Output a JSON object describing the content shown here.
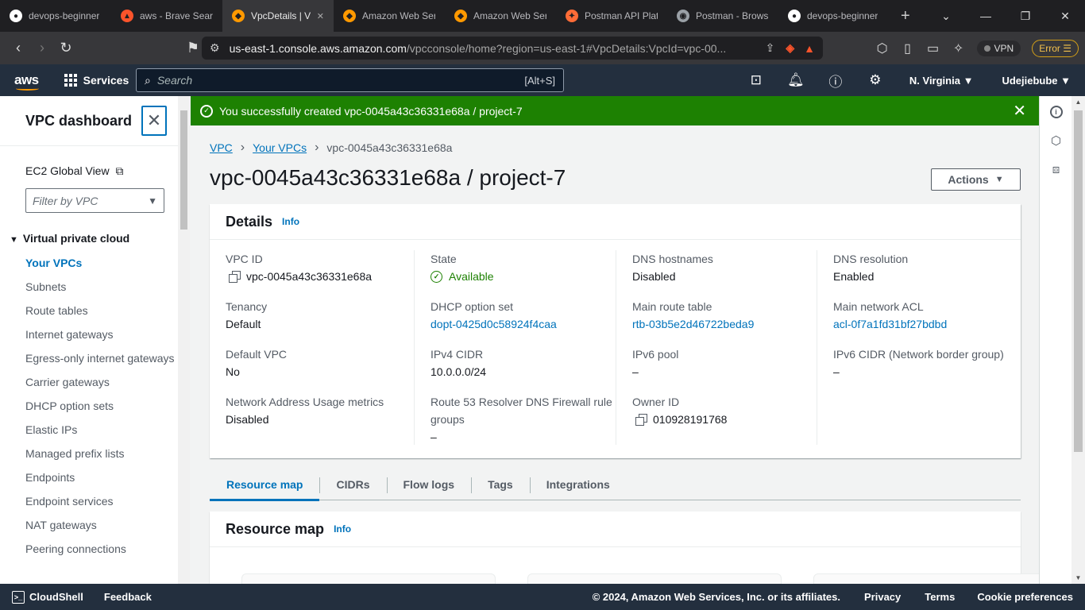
{
  "browser": {
    "tabs": [
      {
        "title": "devops-beginner",
        "icon": "github-icon",
        "color": "#ffffff"
      },
      {
        "title": "aws - Brave Searc",
        "icon": "brave-icon",
        "color": "#fb542b"
      },
      {
        "title": "VpcDetails | V",
        "icon": "aws-cube-icon",
        "color": "#ff9900",
        "active": true
      },
      {
        "title": "Amazon Web Ser",
        "icon": "aws-cube-icon",
        "color": "#ff9900"
      },
      {
        "title": "Amazon Web Ser",
        "icon": "aws-cube-icon",
        "color": "#ff9900"
      },
      {
        "title": "Postman API Plat",
        "icon": "postman-icon",
        "color": "#ff6c37"
      },
      {
        "title": "Postman - Brows",
        "icon": "globe-icon",
        "color": "#9aa0a6"
      },
      {
        "title": "devops-beginner",
        "icon": "github-icon",
        "color": "#ffffff"
      }
    ],
    "url_host": "us-east-1.console.aws.amazon.com",
    "url_path": "/vpcconsole/home?region=us-east-1#VpcDetails:VpcId=vpc-00...",
    "vpn_label": "VPN",
    "error_label": "Error",
    "brave_badge": "1"
  },
  "awsnav": {
    "logo": "aws",
    "services": "Services",
    "search_placeholder": "Search",
    "search_shortcut": "[Alt+S]",
    "region": "N. Virginia",
    "account": "Udejiebube"
  },
  "sidebar": {
    "title": "VPC dashboard",
    "global_view": "EC2 Global View",
    "filter_placeholder": "Filter by VPC",
    "section": "Virtual private cloud",
    "items": [
      {
        "label": "Your VPCs",
        "active": true
      },
      {
        "label": "Subnets"
      },
      {
        "label": "Route tables"
      },
      {
        "label": "Internet gateways"
      },
      {
        "label": "Egress-only internet gateways"
      },
      {
        "label": "Carrier gateways"
      },
      {
        "label": "DHCP option sets"
      },
      {
        "label": "Elastic IPs"
      },
      {
        "label": "Managed prefix lists"
      },
      {
        "label": "Endpoints"
      },
      {
        "label": "Endpoint services"
      },
      {
        "label": "NAT gateways"
      },
      {
        "label": "Peering connections"
      }
    ]
  },
  "flash": {
    "message": "You successfully created vpc-0045a43c36331e68a / project-7",
    "color": "#1d8102"
  },
  "breadcrumb": {
    "vpc": "VPC",
    "your_vpcs": "Your VPCs",
    "current": "vpc-0045a43c36331e68a"
  },
  "page": {
    "title": "vpc-0045a43c36331e68a / project-7",
    "actions": "Actions"
  },
  "details": {
    "title": "Details",
    "info": "Info",
    "columns": [
      [
        {
          "label": "VPC ID",
          "value": "vpc-0045a43c36331e68a",
          "copy": true
        },
        {
          "label": "Tenancy",
          "value": "Default"
        },
        {
          "label": "Default VPC",
          "value": "No"
        },
        {
          "label": "Network Address Usage metrics",
          "value": "Disabled"
        }
      ],
      [
        {
          "label": "State",
          "value": "Available",
          "status": "ok"
        },
        {
          "label": "DHCP option set",
          "value": "dopt-0425d0c58924f4caa",
          "link": true
        },
        {
          "label": "IPv4 CIDR",
          "value": "10.0.0.0/24"
        },
        {
          "label": "Route 53 Resolver DNS Firewall rule groups",
          "value": "–"
        }
      ],
      [
        {
          "label": "DNS hostnames",
          "value": "Disabled"
        },
        {
          "label": "Main route table",
          "value": "rtb-03b5e2d46722beda9",
          "link": true
        },
        {
          "label": "IPv6 pool",
          "value": "–"
        },
        {
          "label": "Owner ID",
          "value": "010928191768",
          "copy": true
        }
      ],
      [
        {
          "label": "DNS resolution",
          "value": "Enabled"
        },
        {
          "label": "Main network ACL",
          "value": "acl-0f7a1fd31bf27bdbd",
          "link": true
        },
        {
          "label": "IPv6 CIDR (Network border group)",
          "value": "–"
        }
      ]
    ]
  },
  "tabs": [
    {
      "label": "Resource map",
      "active": true
    },
    {
      "label": "CIDRs"
    },
    {
      "label": "Flow logs"
    },
    {
      "label": "Tags"
    },
    {
      "label": "Integrations"
    }
  ],
  "resource_map": {
    "title": "Resource map",
    "info": "Info"
  },
  "footer": {
    "cloudshell": "CloudShell",
    "feedback": "Feedback",
    "copyright": "© 2024, Amazon Web Services, Inc. or its affiliates.",
    "privacy": "Privacy",
    "terms": "Terms",
    "cookies": "Cookie preferences"
  }
}
